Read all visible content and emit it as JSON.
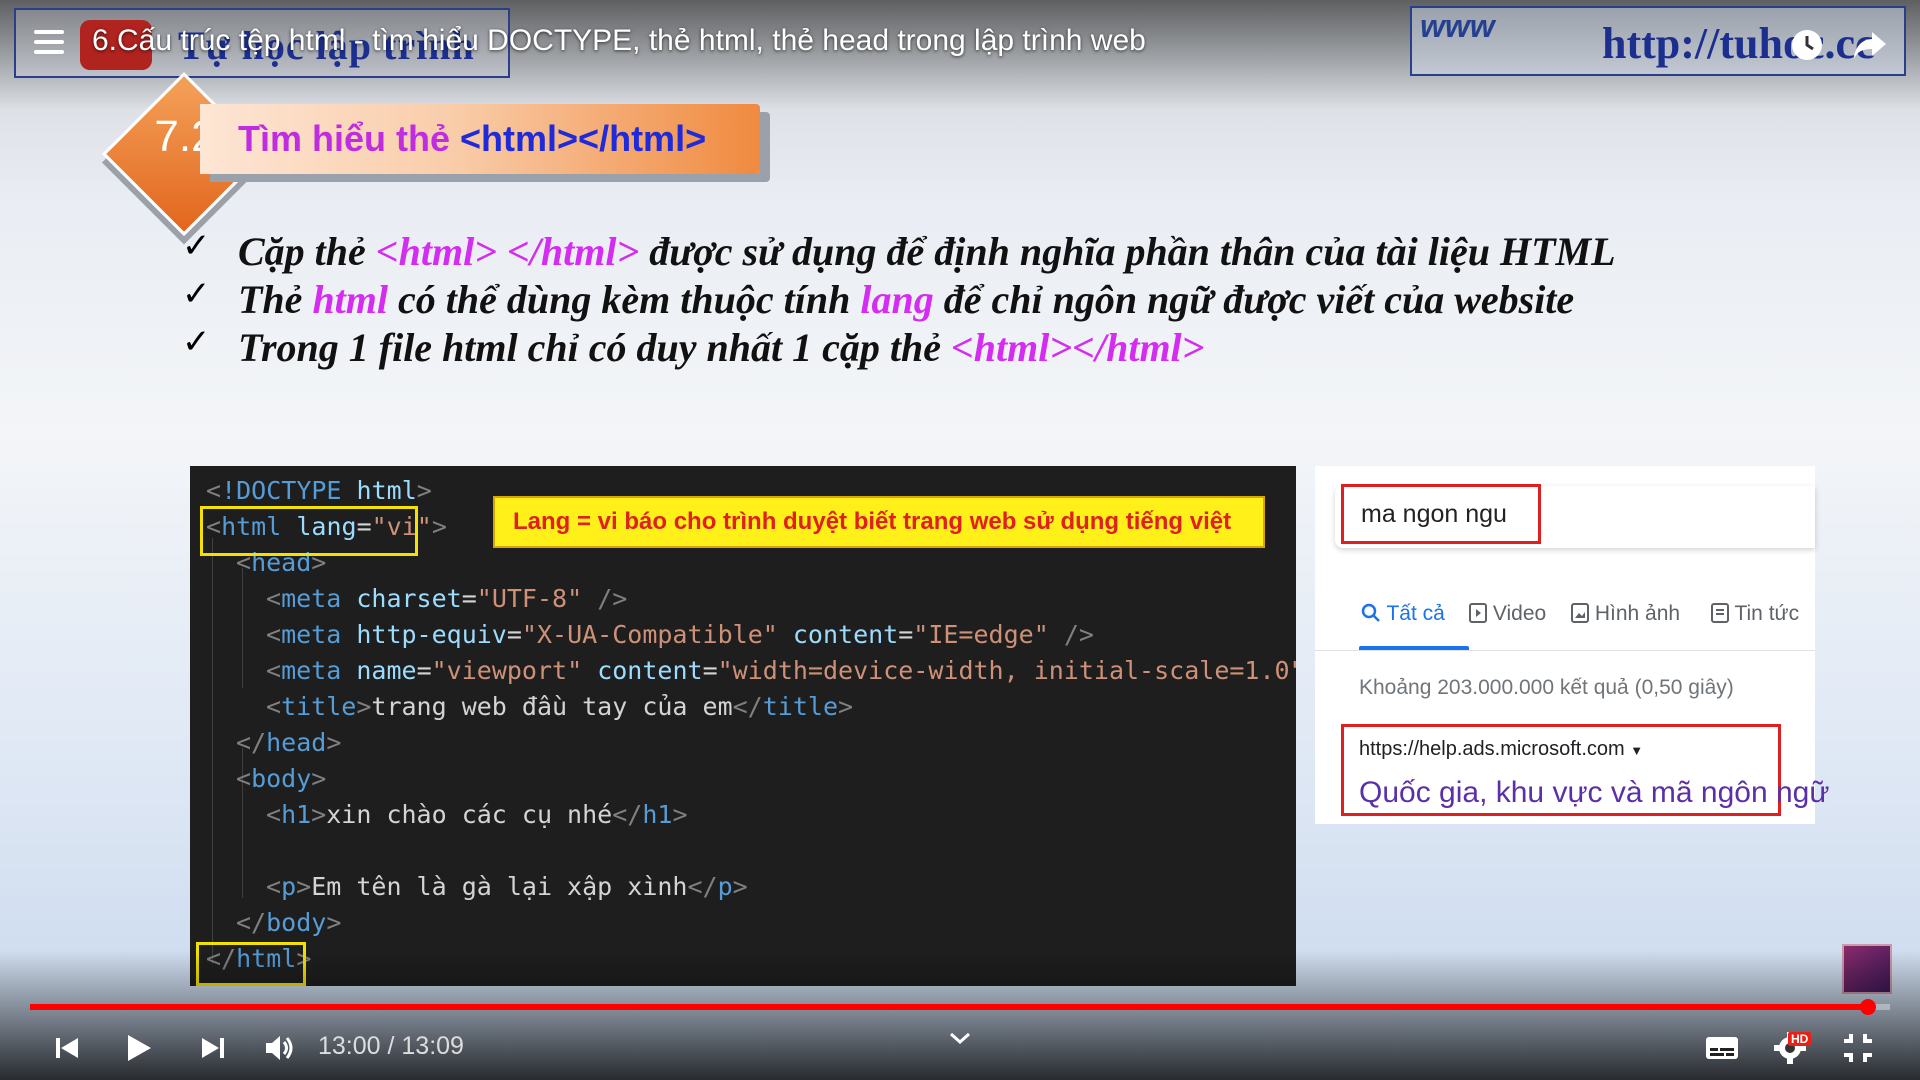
{
  "player": {
    "video_title": "6.Cấu trúc tệp html - tìm hiểu DOCTYPE, thẻ html, thẻ head trong lập trình web",
    "channel_watermark": "Tự học lập trình",
    "url_watermark_prefix": "www",
    "url_watermark": "http://tuhoc.cc",
    "current_time": "13:00",
    "duration": "13:09",
    "time_display": "13:00 / 13:09",
    "progress_fraction": 0.988,
    "quality_badge": "HD",
    "accent_color": "#ff0000",
    "icons": [
      "menu-icon",
      "watch-later-icon",
      "share-icon",
      "previous-icon",
      "play-icon",
      "next-icon",
      "volume-icon",
      "chevron-down-icon",
      "subtitles-icon",
      "settings-icon",
      "exit-fullscreen-icon"
    ]
  },
  "slide": {
    "section_number": "7.2",
    "section_title_prefix": "Tìm hiểu thẻ ",
    "section_title_tag": "<html></html>",
    "bullets": [
      {
        "parts": [
          " Cặp thẻ ",
          "<html>  </html>",
          " được sử dụng để định nghĩa phần thân của tài liệu HTML"
        ]
      },
      {
        "parts": [
          "Thẻ ",
          "html",
          " có thể dùng kèm thuộc tính ",
          "lang",
          " để chỉ ngôn ngữ được viết của website"
        ]
      },
      {
        "parts": [
          "Trong 1 file html chỉ có duy nhất 1 cặp thẻ ",
          "<html></html>"
        ]
      }
    ],
    "callout": "Lang = vi  báo cho trình duyệt biết trang web sử dụng tiếng việt",
    "code_lines": [
      "<!DOCTYPE html>",
      "<html lang=\"vi\">",
      "<head>",
      "<meta charset=\"UTF-8\" />",
      "<meta http-equiv=\"X-UA-Compatible\" content=\"IE=edge\" />",
      "<meta name=\"viewport\" content=\"width=device-width, initial-scale=1.0\"",
      "<title>trang web đầu tay của em</title>",
      "</head>",
      "<body>",
      "<h1>xin chào các cụ nhé</h1>",
      "",
      "<p>Em tên là gà lại xập xình</p>",
      "</body>",
      "</html>"
    ],
    "google": {
      "query": "ma ngon ngu",
      "tabs": [
        "Tất cả",
        "Video",
        "Hình ảnh",
        "Tin tức"
      ],
      "active_tab": "Tất cả",
      "stats": "Khoảng 203.000.000 kết quả (0,50 giây)",
      "result_url": "https://help.ads.microsoft.com",
      "result_title": "Quốc gia, khu vực và mã ngôn ngữ"
    }
  }
}
